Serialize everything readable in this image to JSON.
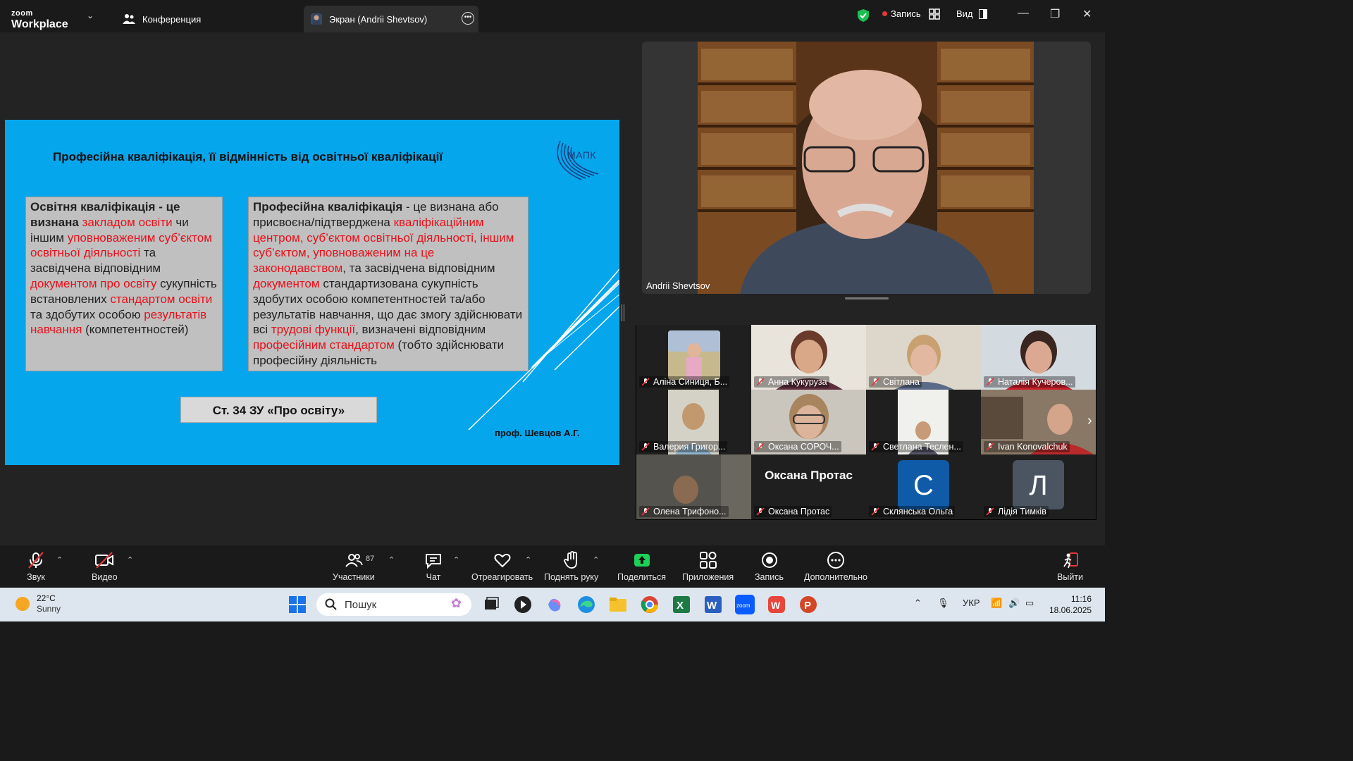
{
  "titlebar": {
    "brand_small": "zoom",
    "brand_large": "Workplace",
    "tabs": [
      {
        "label": "Конференция"
      },
      {
        "label": "Экран (Andrii Shevtsov)"
      }
    ],
    "record_label": "Запись",
    "view_label": "Вид"
  },
  "slide": {
    "title": "Професійна кваліфікація, її відмінність від освітньої кваліфікації",
    "logo_text": "МАПК",
    "box1": {
      "term": "Освітня кваліфікація",
      "p1": " - це визнана ",
      "r1": "закладом освіти",
      "p2": " чи іншим ",
      "r2": "уповноваженим суб’єктом освітньої діяльності",
      "p3": " та засвідчена відповідним ",
      "r3": "документом про освіту",
      "p4": " сукупність встановлених ",
      "r4": "стандартом освіти",
      "p5": " та здобутих особою ",
      "r5": "результатів навчання",
      "p6": " (компетентностей)"
    },
    "box2": {
      "term": "Професійна кваліфікація",
      "p1": " - це визнана або присвоєна/підтверджена ",
      "r1": "кваліфікаційним центром, суб’єктом освітньої діяльності, іншим суб’єктом, уповноваженим на це законодавством",
      "p2": ", та засвідчена відповідним ",
      "r2": "документом",
      "p3": " стандартизована сукупність здобутих особою компетентностей та/або результатів навчання, що дає змогу здійснювати всі ",
      "r3": "трудові функції",
      "p4": ", визначені відповідним ",
      "r4": "професійним стандартом",
      "p5": " (тобто здійснювати професійну діяльність"
    },
    "law_label": "Ст. 34 ЗУ «Про освіту»",
    "author": "проф. Шевцов А.Г."
  },
  "speaker": {
    "name": "Andrii Shevtsov"
  },
  "gallery": [
    {
      "name": "Аліна Синиця, Б..."
    },
    {
      "name": "Анна Кукуруза"
    },
    {
      "name": "Світлана"
    },
    {
      "name": "Наталія Кучеров..."
    },
    {
      "name": "Валерия Григор..."
    },
    {
      "name": "Оксана СОРОЧ..."
    },
    {
      "name": "Светлана Теслен..."
    },
    {
      "name": "Ivan Konovalchuk"
    },
    {
      "name": "Олена Трифоно..."
    },
    {
      "name": "Оксана Протас",
      "display": "Оксана Протас"
    },
    {
      "name": "Склянська Ольга",
      "letter": "С",
      "color": "#0f5ba8"
    },
    {
      "name": "Лідія Тимків",
      "letter": "Л",
      "color": "#4a5561"
    }
  ],
  "toolbar": {
    "audio": "Звук",
    "video": "Видео",
    "participants": "Участники",
    "participants_count": "87",
    "chat": "Чат",
    "react": "Отреагировать",
    "raise_hand": "Поднять руку",
    "share": "Поделиться",
    "apps": "Приложения",
    "record": "Запись",
    "more": "Дополнительно",
    "leave": "Выйти"
  },
  "taskbar": {
    "temp": "22°C",
    "weather": "Sunny",
    "search_placeholder": "Пошук",
    "lang": "УКР",
    "time": "11:16",
    "date": "18.06.2025"
  },
  "colors": {
    "slide_bg": "#06a6ec",
    "accent_red": "#e8101a",
    "share_green": "#1bd158"
  }
}
